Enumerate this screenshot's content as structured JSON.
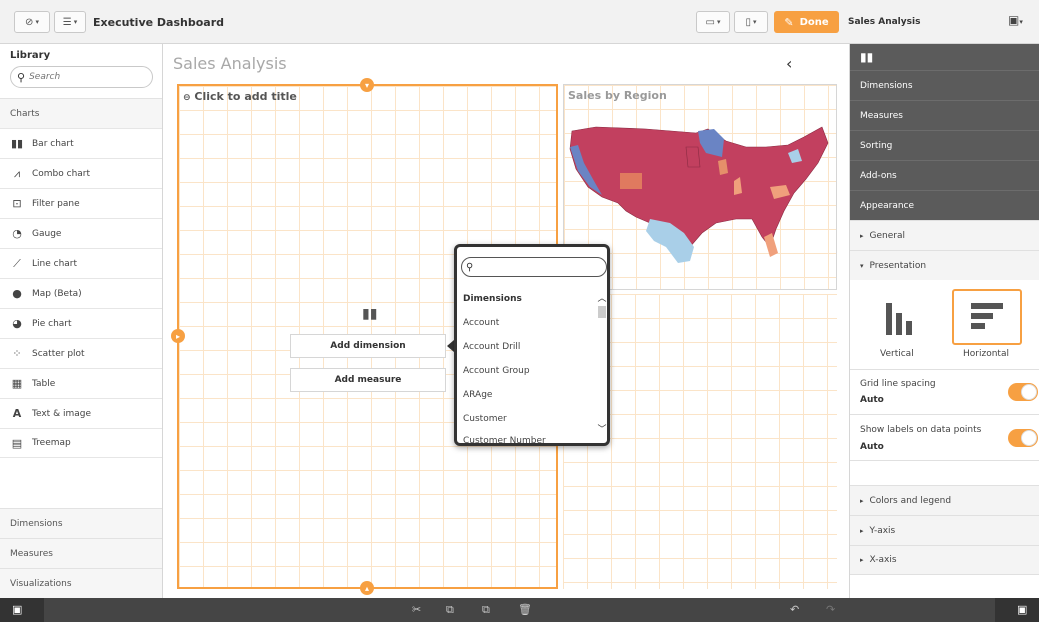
{
  "toolbar": {
    "nav_icon": "compass-icon",
    "list_icon": "list-icon",
    "app_title": "Executive Dashboard",
    "present_icon": "presentation-icon",
    "bookmark_icon": "bookmark-icon",
    "done_label": "Done",
    "sheet_name": "Sales Analysis",
    "device_icon": "device-icon"
  },
  "library": {
    "title": "Library",
    "search_placeholder": "Search",
    "section_charts": "Charts",
    "charts": [
      {
        "label": "Bar chart",
        "icon": "bar-chart-icon"
      },
      {
        "label": "Combo chart",
        "icon": "combo-chart-icon"
      },
      {
        "label": "Filter pane",
        "icon": "filter-pane-icon"
      },
      {
        "label": "Gauge",
        "icon": "gauge-icon"
      },
      {
        "label": "Line chart",
        "icon": "line-chart-icon"
      },
      {
        "label": "Map (Beta)",
        "icon": "globe-icon"
      },
      {
        "label": "Pie chart",
        "icon": "pie-chart-icon"
      },
      {
        "label": "Scatter plot",
        "icon": "scatter-plot-icon"
      },
      {
        "label": "Table",
        "icon": "table-icon"
      },
      {
        "label": "Text & image",
        "icon": "text-icon"
      },
      {
        "label": "Treemap",
        "icon": "treemap-icon"
      }
    ],
    "bottom_sections": [
      "Dimensions",
      "Measures",
      "Visualizations"
    ]
  },
  "canvas": {
    "sheet_title": "Sales Analysis",
    "placeholder_title": "Click to add title",
    "add_dimension": "Add dimension",
    "add_measure": "Add measure",
    "map_title": "Sales by Region",
    "accent": "#f7a042"
  },
  "popup": {
    "search_value": "",
    "header": "Dimensions",
    "items": [
      "Account",
      "Account Drill",
      "Account Group",
      "ARAge",
      "Customer",
      "Customer Number"
    ]
  },
  "properties": {
    "tabs": [
      "Dimensions",
      "Measures",
      "Sorting",
      "Add-ons",
      "Appearance"
    ],
    "general": "General",
    "presentation": "Presentation",
    "orientation_vertical": "Vertical",
    "orientation_horizontal": "Horizontal",
    "grid_line_label": "Grid line spacing",
    "grid_line_value": "Auto",
    "labels_label": "Show labels on data points",
    "labels_value": "Auto",
    "colors_legend": "Colors and legend",
    "y_axis": "Y-axis",
    "x_axis": "X-axis"
  }
}
